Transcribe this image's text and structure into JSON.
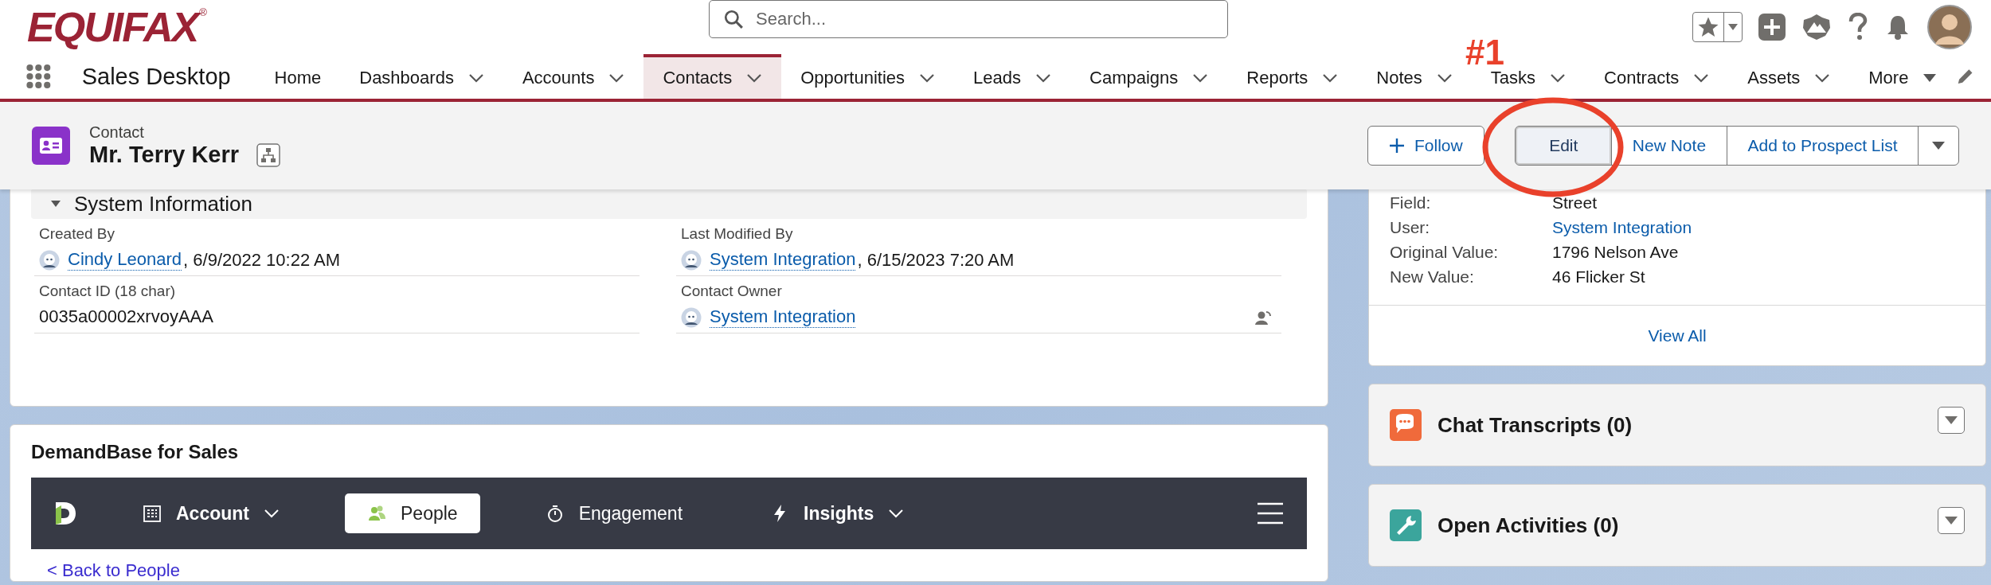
{
  "brand": {
    "logo": "EQUIFAX",
    "mark": "®"
  },
  "search": {
    "placeholder": "Search..."
  },
  "app_name": "Sales Desktop",
  "nav": [
    {
      "label": "Home",
      "kind": "link",
      "selected": false
    },
    {
      "label": "Dashboards",
      "kind": "dropdown",
      "selected": false
    },
    {
      "label": "Accounts",
      "kind": "dropdown",
      "selected": false
    },
    {
      "label": "Contacts",
      "kind": "dropdown",
      "selected": true
    },
    {
      "label": "Opportunities",
      "kind": "dropdown",
      "selected": false
    },
    {
      "label": "Leads",
      "kind": "dropdown",
      "selected": false
    },
    {
      "label": "Campaigns",
      "kind": "dropdown",
      "selected": false
    },
    {
      "label": "Reports",
      "kind": "dropdown",
      "selected": false
    },
    {
      "label": "Notes",
      "kind": "dropdown",
      "selected": false
    },
    {
      "label": "Tasks",
      "kind": "dropdown",
      "selected": false
    },
    {
      "label": "Contracts",
      "kind": "dropdown",
      "selected": false
    },
    {
      "label": "Assets",
      "kind": "dropdown",
      "selected": false
    },
    {
      "label": "More",
      "kind": "overflow",
      "selected": false
    }
  ],
  "annotation": {
    "text": "#1"
  },
  "record": {
    "type": "Contact",
    "name": "Mr. Terry Kerr"
  },
  "actions": [
    {
      "label": "Follow",
      "kind": "follow",
      "focused": false
    },
    {
      "label": "Edit",
      "kind": "grouped",
      "focused": true
    },
    {
      "label": "New Note",
      "kind": "grouped",
      "focused": false
    },
    {
      "label": "Add to Prospect List",
      "kind": "grouped",
      "focused": false
    }
  ],
  "system_information": {
    "title": "System Information",
    "fields": [
      {
        "label": "Created By",
        "kind": "user",
        "user": "Cindy Leonard",
        "suffix": ", 6/9/2022 10:22 AM"
      },
      {
        "label": "Last Modified By",
        "kind": "user",
        "user": "System Integration",
        "suffix": ", 6/15/2023 7:20 AM"
      },
      {
        "label": "Contact ID (18 char)",
        "kind": "text",
        "value": "0035a00002xrvoyAAA"
      },
      {
        "label": "Contact Owner",
        "kind": "owner",
        "user": "System Integration"
      }
    ]
  },
  "demandbase": {
    "title": "DemandBase for Sales",
    "tabs": [
      {
        "label": "Account",
        "menu": true,
        "selected": false
      },
      {
        "label": "People",
        "menu": false,
        "selected": true
      },
      {
        "label": "Engagement",
        "menu": false,
        "selected": false
      },
      {
        "label": "Insights",
        "menu": true,
        "selected": false
      }
    ],
    "back_link": "< Back to People"
  },
  "history": {
    "rows": [
      {
        "label": "Field:",
        "value": "Street",
        "link": false
      },
      {
        "label": "User:",
        "value": "System Integration",
        "link": true
      },
      {
        "label": "Original Value:",
        "value": "1796 Nelson Ave",
        "link": false
      },
      {
        "label": "New Value:",
        "value": "46 Flicker St",
        "link": false
      }
    ],
    "view_all": "View All"
  },
  "related": [
    {
      "title": "Chat Transcripts (0)",
      "kind": "chat"
    },
    {
      "title": "Open Activities (0)",
      "kind": "activities"
    }
  ]
}
